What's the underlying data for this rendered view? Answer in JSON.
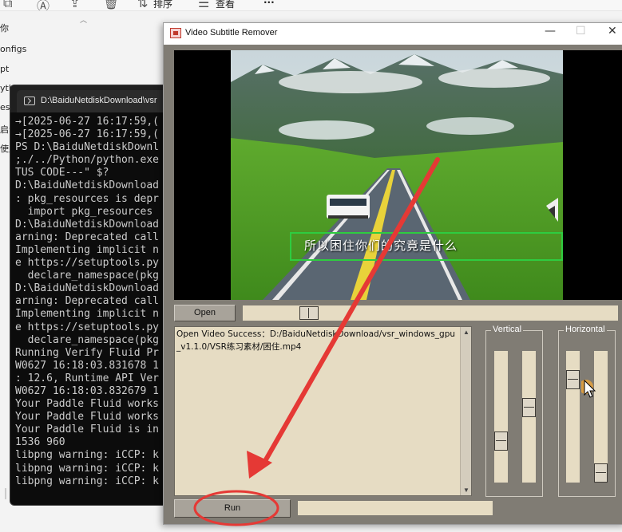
{
  "explorer": {
    "toolbar": {
      "sort_label": "排序",
      "view_label": "查看",
      "more_label": "···"
    },
    "nav_items": [
      "你",
      "onfigs",
      "pt",
      "yth",
      "esc",
      "启动",
      "使用"
    ]
  },
  "terminal": {
    "tab_title": "D:\\BaiduNetdiskDownload\\vsr",
    "lines": [
      "→[2025-06-27 16:17:59,(",
      "→[2025-06-27 16:17:59,(",
      "PS D:\\BaiduNetdiskDownl",
      ";./../Python/python.exe",
      "TUS CODE---\" $?",
      "D:\\BaiduNetdiskDownload",
      ": pkg_resources is depr",
      "  import pkg_resources",
      "D:\\BaiduNetdiskDownload",
      "arning: Deprecated call",
      "Implementing implicit n",
      "e https://setuptools.py",
      "  declare_namespace(pkg",
      "D:\\BaiduNetdiskDownload",
      "arning: Deprecated call",
      "Implementing implicit n",
      "e https://setuptools.py",
      "  declare_namespace(pkg",
      "Running Verify Fluid Pr",
      "W0627 16:18:03.831678 1",
      ": 12.6, Runtime API Ver",
      "W0627 16:18:03.832679 1",
      "Your Paddle Fluid works",
      "Your Paddle Fluid works",
      "Your Paddle Fluid is in",
      "1536 960",
      "libpng warning: iCCP: k",
      "libpng warning: iCCP: k",
      "libpng warning: iCCP: k"
    ]
  },
  "vsr_window": {
    "title": "Video Subtitle Remover",
    "minimize": "—",
    "maximize": "☐",
    "close": "✕",
    "video": {
      "subtitle_text": "所以困住你们的究竟是什么"
    },
    "open_button": "Open",
    "seek_position": 0.16,
    "log_text": "Open Video Success：D:/BaiduNetdiskDownload/vsr_windows_gpu_v1.1.0/VSR练习素材/困住.mp4",
    "vertical_label": "Vertical",
    "horizontal_label": "Horizontal",
    "run_button": "Run"
  },
  "colors": {
    "window_bg": "#807c74",
    "field_bg": "#e6dcc3",
    "annotation_red": "#e53935",
    "subtitle_box": "#2ecc40"
  }
}
